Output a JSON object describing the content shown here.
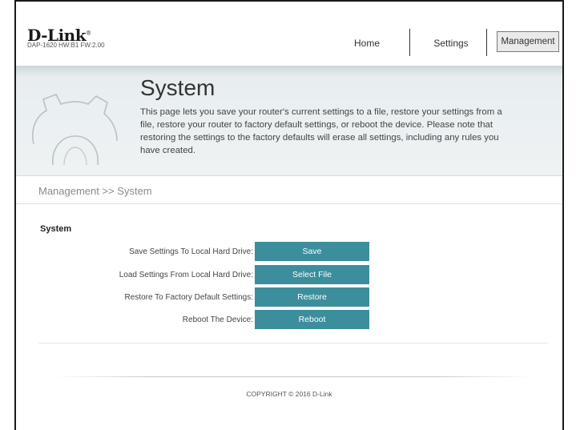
{
  "header": {
    "logo": "D-Link",
    "model_info": "DAP-1620   HW:B1   FW:2.00",
    "nav": {
      "home": "Home",
      "settings": "Settings",
      "management": "Management"
    }
  },
  "banner": {
    "title": "System",
    "description": "This page lets you save your router's current settings to a file, restore your settings from a file, restore your router to factory default settings, or reboot the device. Please note that restoring the settings to the factory defaults will erase all settings, including any rules you have created."
  },
  "breadcrumb": "Management >> System",
  "section": {
    "title": "System",
    "rows": [
      {
        "label": "Save Settings To Local Hard Drive:",
        "button": "Save"
      },
      {
        "label": "Load Settings From Local Hard Drive:",
        "button": "Select File"
      },
      {
        "label": "Restore To Factory Default Settings:",
        "button": "Restore"
      },
      {
        "label": "Reboot The Device:",
        "button": "Reboot"
      }
    ]
  },
  "footer": {
    "copyright": "COPYRIGHT © 2016 D-Link"
  },
  "colors": {
    "button": "#3c8e9d",
    "banner_bg": "#eef2f3"
  },
  "icons": {
    "banner": "gear-icon"
  }
}
